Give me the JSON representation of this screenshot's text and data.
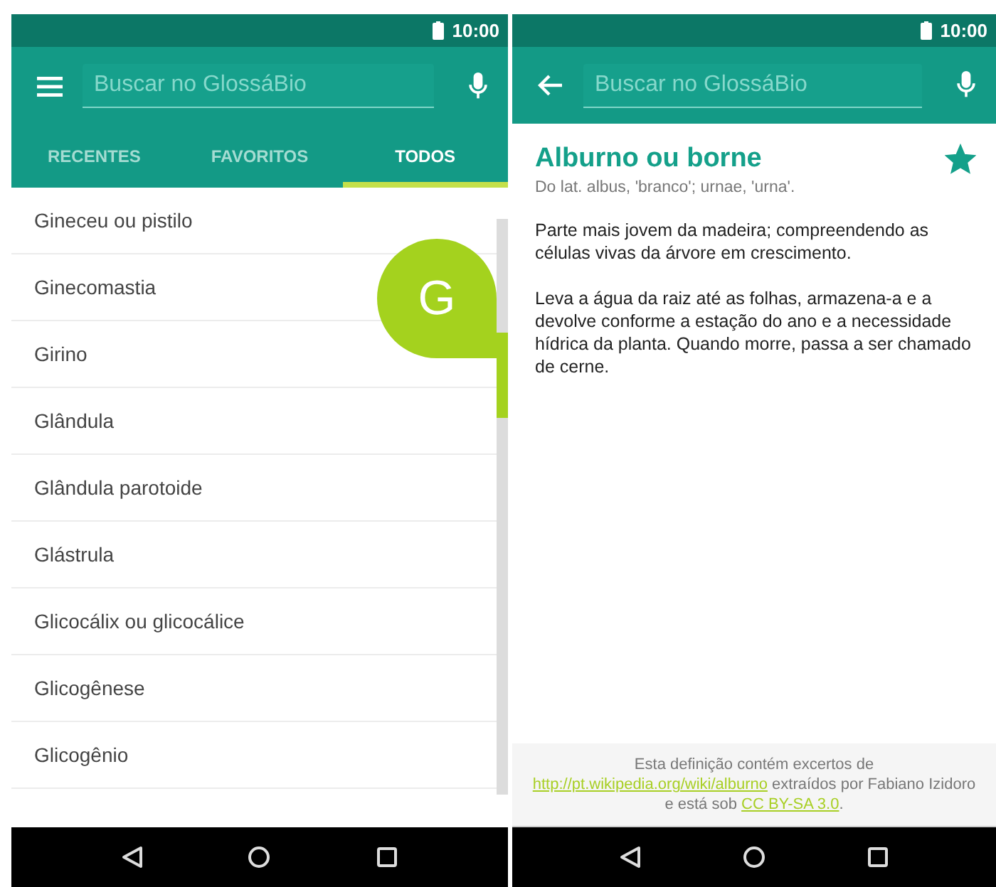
{
  "left_screen": {
    "status_bar": {
      "time": "10:00"
    },
    "toolbar": {
      "search": {
        "placeholder": "Buscar no GlossáBio"
      }
    },
    "tabs": [
      {
        "label": "RECENTES",
        "selected": false
      },
      {
        "label": "FAVORITOS",
        "selected": false
      },
      {
        "label": "TODOS",
        "selected": true
      }
    ],
    "terms": [
      "Gineceu ou pistilo",
      "Ginecomastia",
      "Girino",
      "Glândula",
      "Glândula parotoide",
      "Glástrula",
      "Glicocálix ou glicocálice",
      "Glicogênese",
      "Glicogênio"
    ],
    "fast_scroll": {
      "letter": "G"
    }
  },
  "right_screen": {
    "status_bar": {
      "time": "10:00"
    },
    "toolbar": {
      "search": {
        "placeholder": "Buscar no GlossáBio"
      }
    },
    "entry": {
      "title": "Alburno ou borne",
      "favorite": true,
      "etymology": "Do lat. albus, 'branco'; urnae, 'urna'.",
      "paragraphs": [
        "Parte mais jovem da madeira; compreendendo as células vivas da árvore em crescimento.",
        "Leva a água da raiz até as folhas, armazena-a e a devolve conforme a estação do ano e a necessidade hídrica da planta. Quando morre, passa a ser chamado de cerne."
      ]
    },
    "footer": [
      {
        "kind": "text",
        "text": "Esta definição contém excertos de "
      },
      {
        "kind": "link",
        "text": "http://pt.wikipedia.org/wiki/alburno"
      },
      {
        "kind": "text",
        "text": " extraídos por Fabiano Izidoro e está sob "
      },
      {
        "kind": "link",
        "text": "CC BY-SA 3.0"
      },
      {
        "kind": "text",
        "text": "."
      }
    ]
  }
}
